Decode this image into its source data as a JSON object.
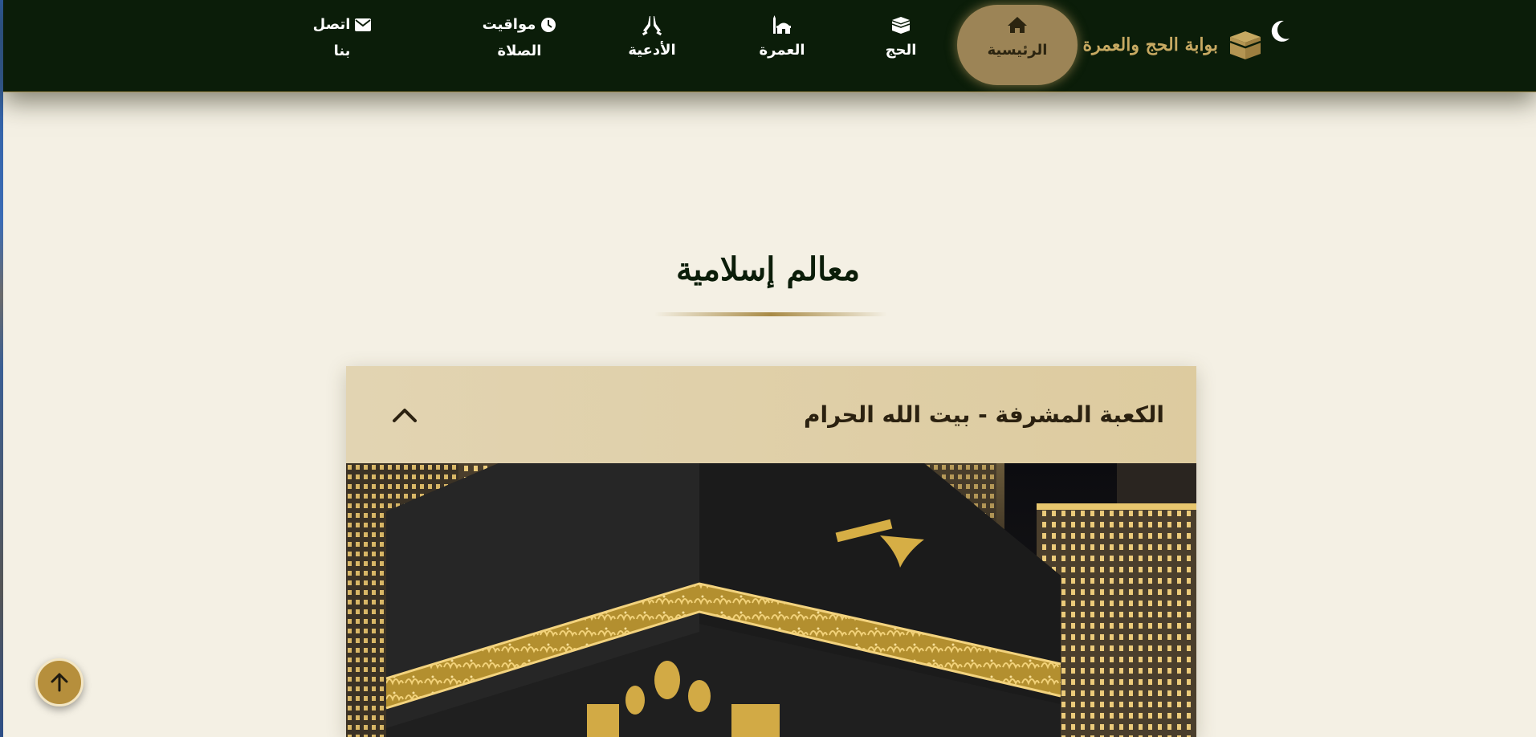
{
  "brand": {
    "title": "بوابة الحج والعمرة"
  },
  "nav": {
    "home": "الرئيسية",
    "hajj": "الحج",
    "umrah": "العمرة",
    "duas": "الأدعية",
    "prayer_times_line1": "مواقيت",
    "prayer_times_line2": "الصلاة",
    "contact_line1": "اتصل",
    "contact_line2": "بنا"
  },
  "section": {
    "title": "معالم إسلامية"
  },
  "card": {
    "title": "الكعبة المشرفة - بيت الله الحرام",
    "expanded": true
  },
  "icons": {
    "theme_toggle": "moon-icon",
    "brand": "kaaba-icon",
    "home": "home-icon",
    "hajj": "kaaba-icon",
    "umrah": "mosque-icon",
    "duas": "praying-hands-icon",
    "prayer_times": "clock-icon",
    "contact": "envelope-icon",
    "collapse": "chevron-up-icon",
    "back_to_top": "arrow-up-icon"
  },
  "colors": {
    "navbar_bg": "#0b1d09",
    "accent_gold": "#c7a962",
    "active_pill": "#9c8456",
    "page_bg": "#f4f0e4",
    "card_header": "#e2d4b2",
    "back_top": "#b68f3c"
  }
}
